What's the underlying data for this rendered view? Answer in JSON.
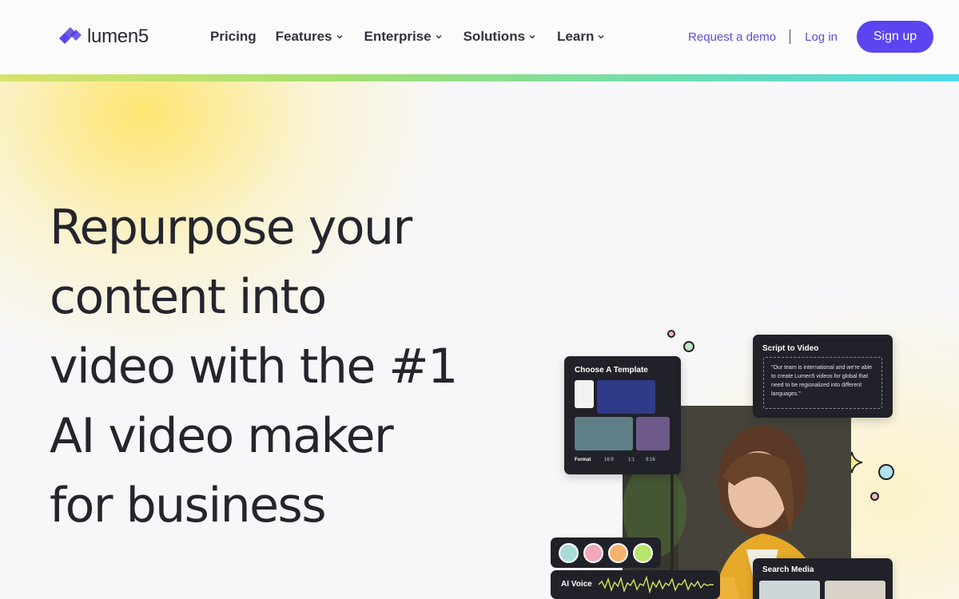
{
  "brand": {
    "name": "lumen5",
    "accent": "#5a45f0"
  },
  "nav": {
    "items": [
      {
        "label": "Pricing",
        "has_dropdown": false
      },
      {
        "label": "Features",
        "has_dropdown": true
      },
      {
        "label": "Enterprise",
        "has_dropdown": true
      },
      {
        "label": "Solutions",
        "has_dropdown": true
      },
      {
        "label": "Learn",
        "has_dropdown": true
      }
    ],
    "request_demo": "Request a demo",
    "login": "Log in",
    "signup": "Sign up"
  },
  "hero": {
    "headline_lines": [
      "Repurpose your",
      "content into",
      "video with the #1",
      "AI video maker",
      "for business"
    ]
  },
  "collage": {
    "template_card": {
      "title": "Choose A Template",
      "format_label": "Format",
      "formats": [
        "16:9",
        "1:1",
        "9:16"
      ]
    },
    "script_card": {
      "title": "Script to Video",
      "quote": "\"Our team is international and we're able to create Lumen5 videos for global that need to be regionalized into different languages.\""
    },
    "voice_card": {
      "label": "AI Voice"
    },
    "search_card": {
      "title": "Search Media"
    }
  }
}
